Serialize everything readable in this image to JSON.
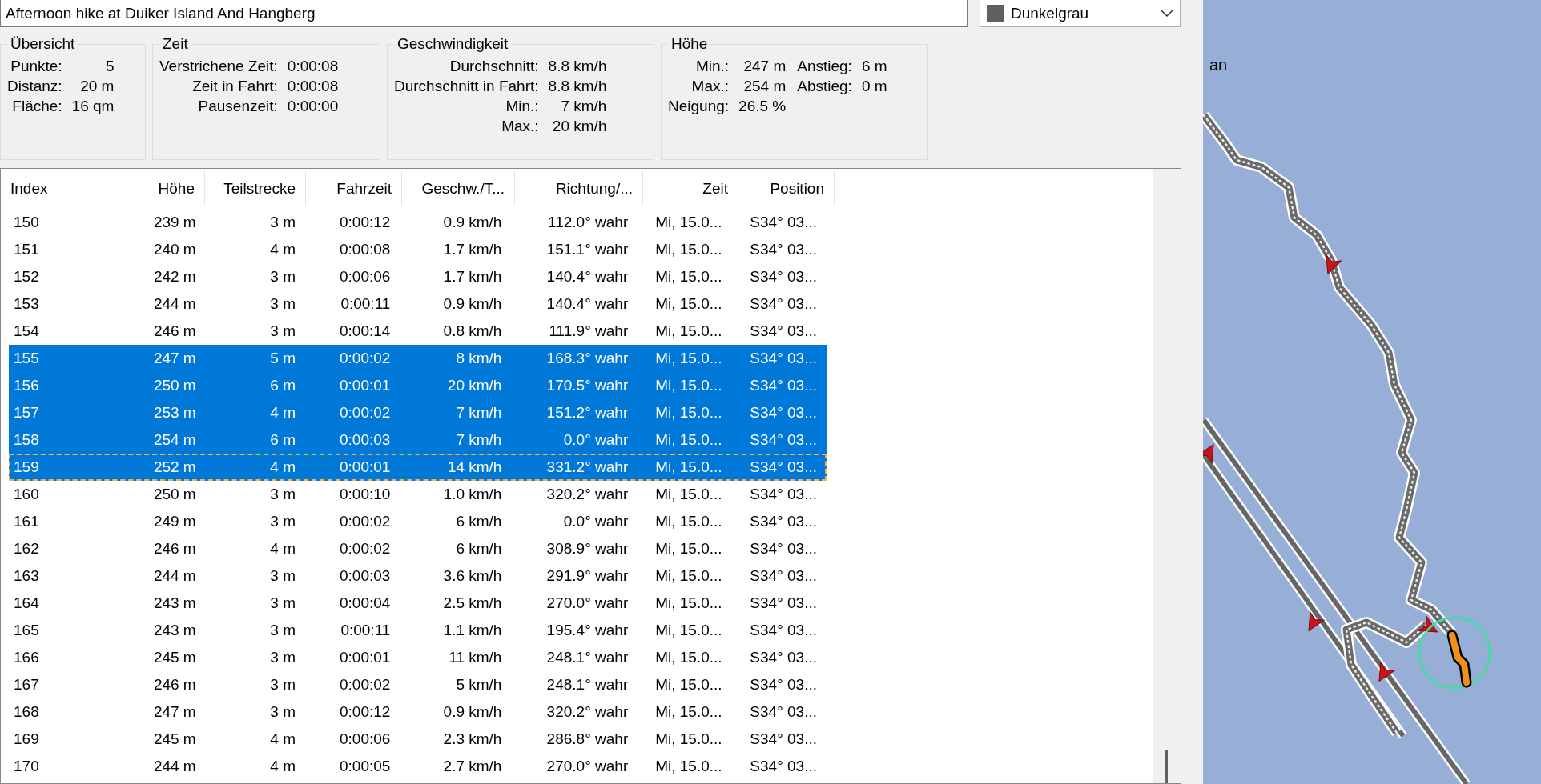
{
  "title_field": {
    "value": "Afternoon hike at Duiker Island And Hangberg"
  },
  "color_dropdown": {
    "value": "Dunkelgrau"
  },
  "groups": [
    {
      "title": "Übersicht",
      "columns": [
        [
          {
            "label": "Punkte:",
            "value": "5"
          },
          {
            "label": "Distanz:",
            "value": "20 m"
          },
          {
            "label": "Fläche:",
            "value": "16 qm"
          }
        ]
      ]
    },
    {
      "title": "Zeit",
      "columns": [
        [
          {
            "label": "Verstrichene Zeit:",
            "value": "0:00:08"
          },
          {
            "label": "Zeit in Fahrt:",
            "value": "0:00:08"
          },
          {
            "label": "Pausenzeit:",
            "value": "0:00:00"
          }
        ]
      ]
    },
    {
      "title": "Geschwindigkeit",
      "columns": [
        [
          {
            "label": "Durchschnitt:",
            "value": "8.8 km/h"
          },
          {
            "label": "Durchschnitt in Fahrt:",
            "value": "8.8 km/h"
          },
          {
            "label": "Min.:",
            "value": "7 km/h"
          },
          {
            "label": "Max.:",
            "value": "20 km/h"
          }
        ]
      ]
    },
    {
      "title": "Höhe",
      "columns": [
        [
          {
            "label": "Min.:",
            "value": "247 m"
          },
          {
            "label": "Max.:",
            "value": "254 m"
          },
          {
            "label": "Neigung:",
            "value": "26.5 %"
          }
        ],
        [
          {
            "label": "Anstieg:",
            "value": "6 m"
          },
          {
            "label": "Abstieg:",
            "value": "0 m"
          }
        ]
      ]
    }
  ],
  "table": {
    "columns": [
      "Index",
      "Höhe",
      "Teilstrecke",
      "Fahrzeit",
      "Geschw./T...",
      "Richtung/...",
      "Zeit",
      "Position"
    ],
    "rows": [
      {
        "cells": [
          "150",
          "239 m",
          "3 m",
          "0:00:12",
          "0.9 km/h",
          "112.0° wahr",
          "Mi, 15.0...",
          "S34° 03..."
        ],
        "selected": false,
        "focused": false
      },
      {
        "cells": [
          "151",
          "240 m",
          "4 m",
          "0:00:08",
          "1.7 km/h",
          "151.1° wahr",
          "Mi, 15.0...",
          "S34° 03..."
        ],
        "selected": false,
        "focused": false
      },
      {
        "cells": [
          "152",
          "242 m",
          "3 m",
          "0:00:06",
          "1.7 km/h",
          "140.4° wahr",
          "Mi, 15.0...",
          "S34° 03..."
        ],
        "selected": false,
        "focused": false
      },
      {
        "cells": [
          "153",
          "244 m",
          "3 m",
          "0:00:11",
          "0.9 km/h",
          "140.4° wahr",
          "Mi, 15.0...",
          "S34° 03..."
        ],
        "selected": false,
        "focused": false
      },
      {
        "cells": [
          "154",
          "246 m",
          "3 m",
          "0:00:14",
          "0.8 km/h",
          "111.9° wahr",
          "Mi, 15.0...",
          "S34° 03..."
        ],
        "selected": false,
        "focused": false
      },
      {
        "cells": [
          "155",
          "247 m",
          "5 m",
          "0:00:02",
          "8 km/h",
          "168.3° wahr",
          "Mi, 15.0...",
          "S34° 03..."
        ],
        "selected": true,
        "focused": false
      },
      {
        "cells": [
          "156",
          "250 m",
          "6 m",
          "0:00:01",
          "20 km/h",
          "170.5° wahr",
          "Mi, 15.0...",
          "S34° 03..."
        ],
        "selected": true,
        "focused": false
      },
      {
        "cells": [
          "157",
          "253 m",
          "4 m",
          "0:00:02",
          "7 km/h",
          "151.2° wahr",
          "Mi, 15.0...",
          "S34° 03..."
        ],
        "selected": true,
        "focused": false
      },
      {
        "cells": [
          "158",
          "254 m",
          "6 m",
          "0:00:03",
          "7 km/h",
          "0.0° wahr",
          "Mi, 15.0...",
          "S34° 03..."
        ],
        "selected": true,
        "focused": false
      },
      {
        "cells": [
          "159",
          "252 m",
          "4 m",
          "0:00:01",
          "14 km/h",
          "331.2° wahr",
          "Mi, 15.0...",
          "S34° 03..."
        ],
        "selected": true,
        "focused": true
      },
      {
        "cells": [
          "160",
          "250 m",
          "3 m",
          "0:00:10",
          "1.0 km/h",
          "320.2° wahr",
          "Mi, 15.0...",
          "S34° 03..."
        ],
        "selected": false,
        "focused": false
      },
      {
        "cells": [
          "161",
          "249 m",
          "3 m",
          "0:00:02",
          "6 km/h",
          "0.0° wahr",
          "Mi, 15.0...",
          "S34° 03..."
        ],
        "selected": false,
        "focused": false
      },
      {
        "cells": [
          "162",
          "246 m",
          "4 m",
          "0:00:02",
          "6 km/h",
          "308.9° wahr",
          "Mi, 15.0...",
          "S34° 03..."
        ],
        "selected": false,
        "focused": false
      },
      {
        "cells": [
          "163",
          "244 m",
          "3 m",
          "0:00:03",
          "3.6 km/h",
          "291.9° wahr",
          "Mi, 15.0...",
          "S34° 03..."
        ],
        "selected": false,
        "focused": false
      },
      {
        "cells": [
          "164",
          "243 m",
          "3 m",
          "0:00:04",
          "2.5 km/h",
          "270.0° wahr",
          "Mi, 15.0...",
          "S34° 03..."
        ],
        "selected": false,
        "focused": false
      },
      {
        "cells": [
          "165",
          "243 m",
          "3 m",
          "0:00:11",
          "1.1 km/h",
          "195.4° wahr",
          "Mi, 15.0...",
          "S34° 03..."
        ],
        "selected": false,
        "focused": false
      },
      {
        "cells": [
          "166",
          "245 m",
          "3 m",
          "0:00:01",
          "11 km/h",
          "248.1° wahr",
          "Mi, 15.0...",
          "S34° 03..."
        ],
        "selected": false,
        "focused": false
      },
      {
        "cells": [
          "167",
          "246 m",
          "3 m",
          "0:00:02",
          "5 km/h",
          "248.1° wahr",
          "Mi, 15.0...",
          "S34° 03..."
        ],
        "selected": false,
        "focused": false
      },
      {
        "cells": [
          "168",
          "247 m",
          "3 m",
          "0:00:12",
          "0.9 km/h",
          "320.2° wahr",
          "Mi, 15.0...",
          "S34° 03..."
        ],
        "selected": false,
        "focused": false
      },
      {
        "cells": [
          "169",
          "245 m",
          "4 m",
          "0:00:06",
          "2.3 km/h",
          "286.8° wahr",
          "Mi, 15.0...",
          "S34° 03..."
        ],
        "selected": false,
        "focused": false
      },
      {
        "cells": [
          "170",
          "244 m",
          "4 m",
          "0:00:05",
          "2.7 km/h",
          "270.0° wahr",
          "Mi, 15.0...",
          "S34° 03..."
        ],
        "selected": false,
        "focused": false
      }
    ]
  },
  "map": {
    "label": "an"
  }
}
